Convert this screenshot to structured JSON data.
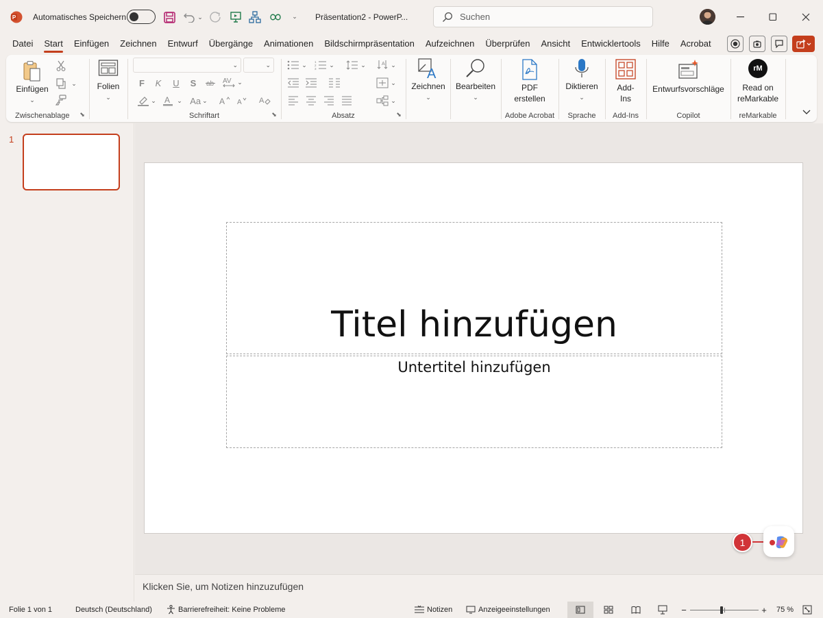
{
  "titlebar": {
    "autosave_label": "Automatisches Speichern",
    "doc_title": "Präsentation2 - PowerP...",
    "search_placeholder": "Suchen"
  },
  "menu": [
    "Datei",
    "Start",
    "Einfügen",
    "Zeichnen",
    "Entwurf",
    "Übergänge",
    "Animationen",
    "Bildschirmpräsentation",
    "Aufzeichnen",
    "Überprüfen",
    "Ansicht",
    "Entwicklertools",
    "Hilfe",
    "Acrobat"
  ],
  "ribbon": {
    "clipboard": {
      "paste": "Einfügen",
      "group": "Zwischenablage"
    },
    "slides": {
      "label": "Folien"
    },
    "font": {
      "group": "Schriftart",
      "bold": "F",
      "italic": "K",
      "underline": "U",
      "strike": "S",
      "case": "Aa"
    },
    "paragraph": {
      "group": "Absatz"
    },
    "draw": {
      "label": "Zeichnen"
    },
    "edit": {
      "label": "Bearbeiten"
    },
    "acrobat": {
      "label1": "PDF",
      "label2": "erstellen",
      "group": "Adobe Acrobat"
    },
    "voice": {
      "label": "Diktieren",
      "group": "Sprache"
    },
    "addins": {
      "label1": "Add-",
      "label2": "Ins",
      "group": "Add-Ins"
    },
    "copilot": {
      "label": "Entwurfsvorschläge",
      "group": "Copilot"
    },
    "remarkable": {
      "logo": "rM",
      "label1": "Read on",
      "label2": "reMarkable",
      "group": "reMarkable"
    }
  },
  "thumbnails": [
    {
      "number": "1"
    }
  ],
  "slide": {
    "title_placeholder": "Titel hinzufügen",
    "subtitle_placeholder": "Untertitel hinzufügen"
  },
  "copilot_badge": "1",
  "notes_placeholder": "Klicken Sie, um Notizen hinzuzufügen",
  "status": {
    "slide_info": "Folie 1 von 1",
    "language": "Deutsch (Deutschland)",
    "accessibility": "Barrierefreiheit: Keine Probleme",
    "notes": "Notizen",
    "display_settings": "Anzeigeeinstellungen",
    "zoom": "75 %",
    "zoom_level": 0.5
  },
  "colors": {
    "accent": "#c43e1c",
    "background": "#f3efec",
    "save_icon": "#b3246f",
    "copilot_badge": "#d13438"
  }
}
